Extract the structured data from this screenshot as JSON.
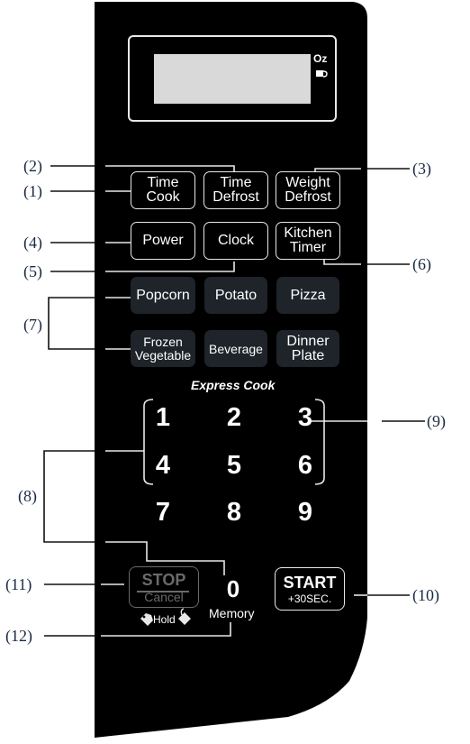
{
  "display": {
    "unit_label": "Oz",
    "beverage_icon": "cup-icon"
  },
  "buttons": {
    "time_cook": {
      "line1": "Time",
      "line2": "Cook"
    },
    "time_defrost": {
      "line1": "Time",
      "line2": "Defrost"
    },
    "weight_defrost": {
      "line1": "Weight",
      "line2": "Defrost"
    },
    "power": {
      "label": "Power"
    },
    "clock": {
      "label": "Clock"
    },
    "kitchen_timer": {
      "line1": "Kitchen",
      "line2": "Timer"
    },
    "popcorn": {
      "label": "Popcorn"
    },
    "potato": {
      "label": "Potato"
    },
    "pizza": {
      "label": "Pizza"
    },
    "frozen_vegetable": {
      "line1": "Frozen",
      "line2": "Vegetable"
    },
    "beverage": {
      "label": "Beverage"
    },
    "dinner_plate": {
      "line1": "Dinner",
      "line2": "Plate"
    },
    "stop": {
      "line1": "STOP",
      "line2": "Cancel"
    },
    "start": {
      "line1": "START",
      "line2": "+30SEC."
    }
  },
  "express_cook_label": "Express Cook",
  "numbers": [
    "1",
    "2",
    "3",
    "4",
    "5",
    "6",
    "7",
    "8",
    "9",
    "0"
  ],
  "hold_label": "Hold",
  "memory_label": "Memory",
  "callouts": {
    "c1": "(1)",
    "c2": "(2)",
    "c3": "(3)",
    "c4": "(4)",
    "c5": "(5)",
    "c6": "(6)",
    "c7": "(7)",
    "c8": "(8)",
    "c9": "(9)",
    "c10": "(10)",
    "c11": "(11)",
    "c12": "(12)"
  },
  "colors": {
    "panel": "#000000",
    "food_button": "#1e2429",
    "stop_button": "#6a6a6a",
    "callout_text": "#1a2a44"
  }
}
